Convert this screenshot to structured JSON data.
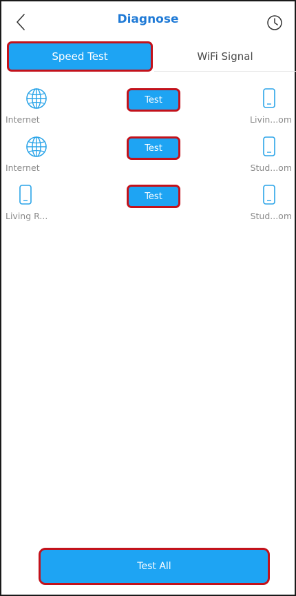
{
  "header": {
    "title": "Diagnose"
  },
  "tabs": [
    {
      "label": "Speed Test",
      "active": true
    },
    {
      "label": "WiFi Signal",
      "active": false
    }
  ],
  "tests": [
    {
      "from": "Internet",
      "from_icon": "globe-icon",
      "button": "Test",
      "to": "Livin...om",
      "to_icon": "router-icon"
    },
    {
      "from": "Internet",
      "from_icon": "globe-icon",
      "button": "Test",
      "to": "Stud...om",
      "to_icon": "router-icon"
    },
    {
      "from": "Living R...",
      "from_icon": "router-icon",
      "button": "Test",
      "to": "Stud...om",
      "to_icon": "router-icon"
    }
  ],
  "footer": {
    "test_all_label": "Test All"
  },
  "colors": {
    "accent": "#1ea4f3",
    "title": "#1f7ad6",
    "highlight_border": "#c3121b",
    "icon": "#2aa4e8"
  }
}
